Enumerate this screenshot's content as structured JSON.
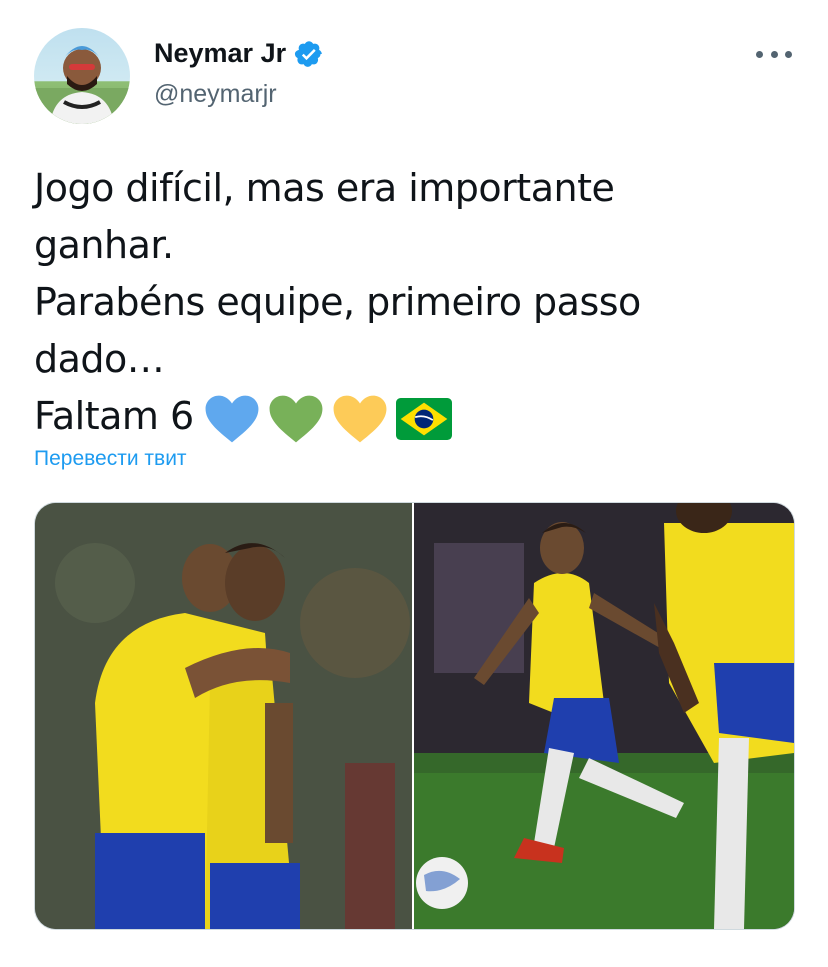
{
  "tweet": {
    "author": {
      "display_name": "Neymar Jr",
      "handle": "@neymarjr",
      "verified": true
    },
    "text_lines": [
      "Jogo difícil, mas era importante",
      "ganhar.",
      "Parabéns equipe, primeiro passo",
      "dado…",
      "Faltam 6"
    ],
    "emojis": [
      "blue-heart-icon",
      "green-heart-icon",
      "yellow-heart-icon",
      "brazil-flag-icon"
    ],
    "translate_label": "Перевести твит"
  },
  "colors": {
    "accent": "#1d9bf0",
    "text_primary": "#0f1419",
    "text_secondary": "#536471",
    "blue_heart": "#5fa8ee",
    "green_heart": "#78b159",
    "yellow_heart": "#fdcb58"
  }
}
